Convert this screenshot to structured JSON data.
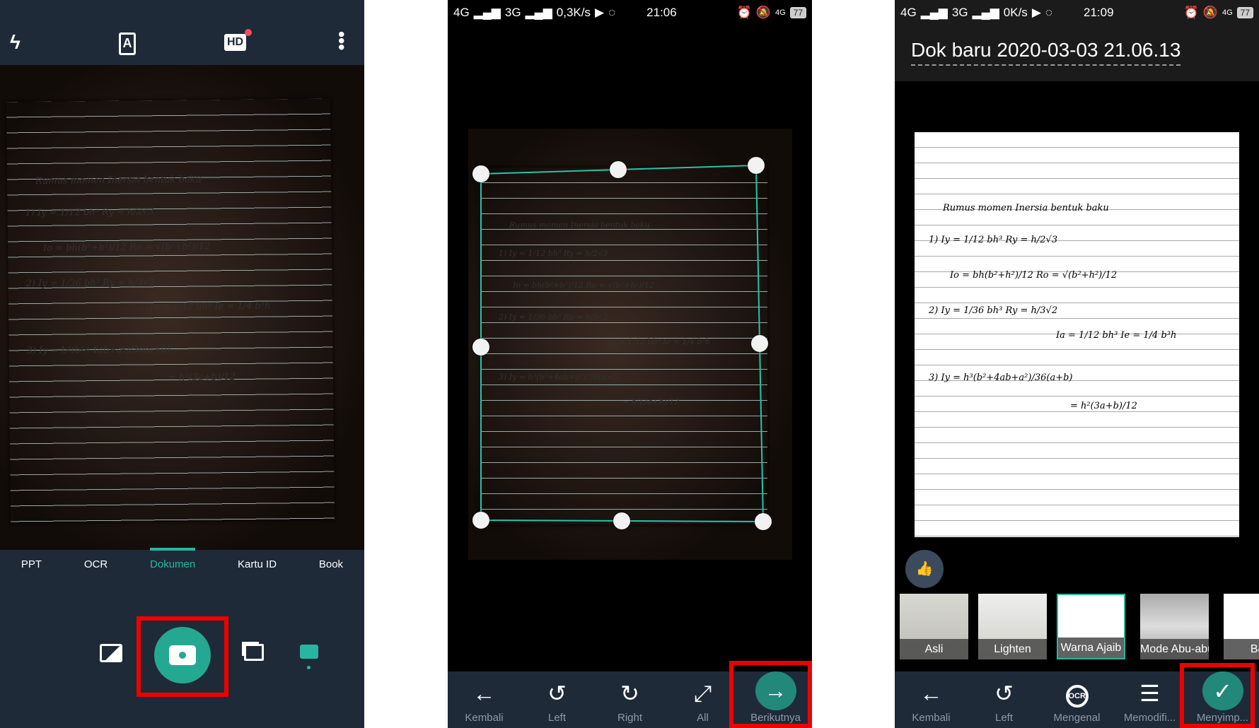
{
  "camera": {
    "top_icons": [
      "flash-auto-icon",
      "text-mode-icon",
      "hd-icon",
      "more-vert-icon"
    ],
    "hd_label": "HD",
    "text_icon_label": "A",
    "modes": [
      "PPT",
      "OCR",
      "Dokumen",
      "Kartu ID",
      "Book"
    ],
    "active_mode": "Dokumen",
    "bottom_icons": [
      "gallery-icon",
      "camera-shutter-icon",
      "batch-icon",
      "single-shot-icon"
    ]
  },
  "crop": {
    "status": {
      "net1": "4G",
      "net2": "3G",
      "speed": "0,3K/s",
      "time": "21:06",
      "net3": "4G",
      "battery": "77"
    },
    "toolbar": [
      {
        "icon": "←",
        "label": "Kembali"
      },
      {
        "icon": "↺",
        "label": "Left"
      },
      {
        "icon": "↻",
        "label": "Right"
      },
      {
        "icon": "⤢",
        "label": "All"
      },
      {
        "icon": "→",
        "label": "Berikutnya"
      }
    ]
  },
  "edit": {
    "status": {
      "net1": "4G",
      "net2": "3G",
      "speed": "0K/s",
      "time": "21:09",
      "net3": "4G",
      "battery": "77"
    },
    "title": "Dok baru 2020-03-03 21.06.13",
    "filters": [
      "Asli",
      "Lighten",
      "Warna Ajaib",
      "Mode Abu-abu",
      "B&"
    ],
    "selected_filter": "Warna Ajaib",
    "ocr_badge": "OCR",
    "toolbar": [
      {
        "icon": "←",
        "label": "Kembali"
      },
      {
        "icon": "↺",
        "label": "Left"
      },
      {
        "icon": "🔍",
        "label": "Mengenal"
      },
      {
        "icon": "☰",
        "label": "Memodifi..."
      },
      {
        "icon": "✓",
        "label": "Menyimp..."
      }
    ]
  },
  "notes": {
    "l1": "Rumus momen Inersia bentuk baku",
    "l2": "1)  Iy = 1/12 bh³   Ry = h/2√3",
    "l3": "Io = bh(b²+h²)/12   Ro = √(b²+h²)/12",
    "l4": "2)  Iy = 1/36 bh³   Ry = h/3√2",
    "l5": "Ia = 1/12 bh³   Ie = 1/4 b³h",
    "l6": "3)  Iy = h³(b²+4ab+a²)/36(a+b)",
    "l7": "= h²(3a+b)/12"
  },
  "colors": {
    "accent": "#29b6a0",
    "highlight": "#ee0000",
    "bar": "#1e2a38"
  }
}
